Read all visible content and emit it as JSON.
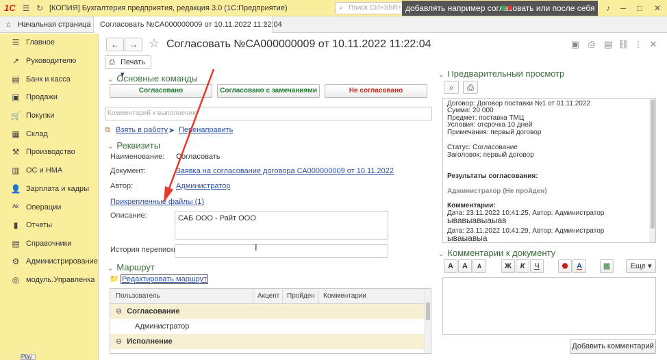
{
  "titlebar": {
    "logo": "1С",
    "app_title": "[КОПИЯ] Бухгалтерия предприятия, редакция 3.0  (1С:Предприятие)",
    "search_placeholder": "Поиск Ctrl+Shift+F",
    "overlay_text": "добавлять например согласовать или после себя"
  },
  "tabs": {
    "home": "Начальная страница",
    "doc": "Согласовать №СА000000009 от 10.11.2022 11:22:04",
    "close": "×"
  },
  "sidebar": {
    "items": [
      {
        "label": "Главное",
        "icon": "☰"
      },
      {
        "label": "Руководителю",
        "icon": "↗"
      },
      {
        "label": "Банк и касса",
        "icon": "▤"
      },
      {
        "label": "Продажи",
        "icon": "▣"
      },
      {
        "label": "Покупки",
        "icon": "🛒"
      },
      {
        "label": "Склад",
        "icon": "▦"
      },
      {
        "label": "Производство",
        "icon": "⚒"
      },
      {
        "label": "ОС и НМА",
        "icon": "▥"
      },
      {
        "label": "Зарплата и кадры",
        "icon": "👤"
      },
      {
        "label": "Операции",
        "icon": "ᴬᵏ"
      },
      {
        "label": "Отчеты",
        "icon": "▮"
      },
      {
        "label": "Справочники",
        "icon": "▤"
      },
      {
        "label": "Администрирование",
        "icon": "⚙"
      },
      {
        "label": "модуль.Управленка",
        "icon": "◎"
      }
    ],
    "play_tip": "Play"
  },
  "form": {
    "title": "Согласовать №СА000000009 от 10.11.2022 11:22:04",
    "print_label": "Печать",
    "main_commands_title": "Основные команды",
    "btn_approved": "Согласовано",
    "btn_approved_remarks": "Согласовано с замечаниями",
    "btn_not_approved": "Не согласовано",
    "comment_placeholder": "Комментарий к выполнению",
    "take_to_work": "Взять в работу",
    "redirect": "Перенаправить",
    "details_title": "Реквизиты",
    "name_label": "Наименование:",
    "name_value": "Согласовать",
    "doc_label": "Документ:",
    "doc_value": "Заявка на согласование договора СА000000009 от 10.11.2022",
    "author_label": "Автор:",
    "author_value": "Администратор",
    "attached_files": "Прикрепленные файлы (1)",
    "description_label": "Описание:",
    "description_value": "САБ ООО - Райт ООО",
    "history_label": "История переписки:",
    "route_title": "Маршрут",
    "edit_route": "Редактировать маршрут"
  },
  "route_table": {
    "columns": [
      "Пользователь",
      "Акцепт",
      "Пройден",
      "Комментарии"
    ],
    "rows": [
      {
        "type": "group",
        "text": "Согласование"
      },
      {
        "type": "item",
        "text": "Администратор"
      },
      {
        "type": "group",
        "text": "Исполнение"
      }
    ]
  },
  "preview": {
    "title": "Предварительный просмотр",
    "lines": [
      "Договор: Договор поставки №1 от 01.11.2022",
      "Сумма: 20 000",
      "Предмет: поставка ТМЦ",
      "Условия: отсрочка 10 дней",
      "Примечания: первый договор",
      "Статус: Согласование",
      "Заголовок: первый договор",
      "Результаты согласования:",
      "Администратор (Не пройден)",
      "Комментарии:",
      "Дата: 23.11.2022 10:41:25, Автор: Администратор",
      "ывавыавыаыав",
      "Дата: 23.11.2022 10:41:29, Автор: Администратор",
      "ываыавыа"
    ]
  },
  "doc_comments": {
    "title": "Комментарии к документу",
    "more": "Еще",
    "add_button": "Добавить комментарий",
    "tools": [
      "A",
      "A",
      "A",
      "Ж",
      "К",
      "Ч",
      "A"
    ]
  },
  "colors": {
    "accent_yellow": "#fbed9e",
    "section_green": "#3b6b3b",
    "approved_green": "#1f7a2e",
    "not_approved_red": "#c8201a",
    "link_blue": "#2b50a6",
    "arrow_red": "#e8392b"
  }
}
